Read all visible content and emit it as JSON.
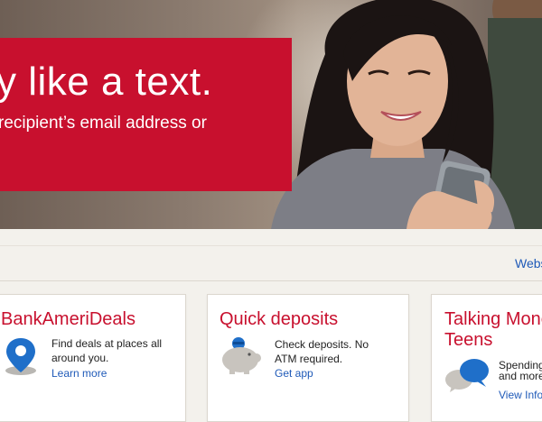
{
  "hero": {
    "headline": "y like a text.",
    "subtext": "recipient’s email address or"
  },
  "strip": {
    "right_link": "Webs"
  },
  "cards": [
    {
      "title": "BankAmeriDeals",
      "text": "Find deals at places all around you.",
      "link": "Learn more",
      "icon": "map-pin-icon"
    },
    {
      "title": "Quick deposits",
      "text": "Check deposits. No ATM required.",
      "link": "Get app",
      "icon": "piggy-bank-icon"
    },
    {
      "title_line1": "Talking Mone",
      "title_line2": "Teens",
      "text_line1": "Spending",
      "text_line2": "and more",
      "link": "View Infog",
      "icon": "speech-bubbles-icon"
    }
  ],
  "colors": {
    "brand_red": "#c8102e",
    "link_blue": "#1f5ab8",
    "page_bg": "#f3f1ec"
  }
}
